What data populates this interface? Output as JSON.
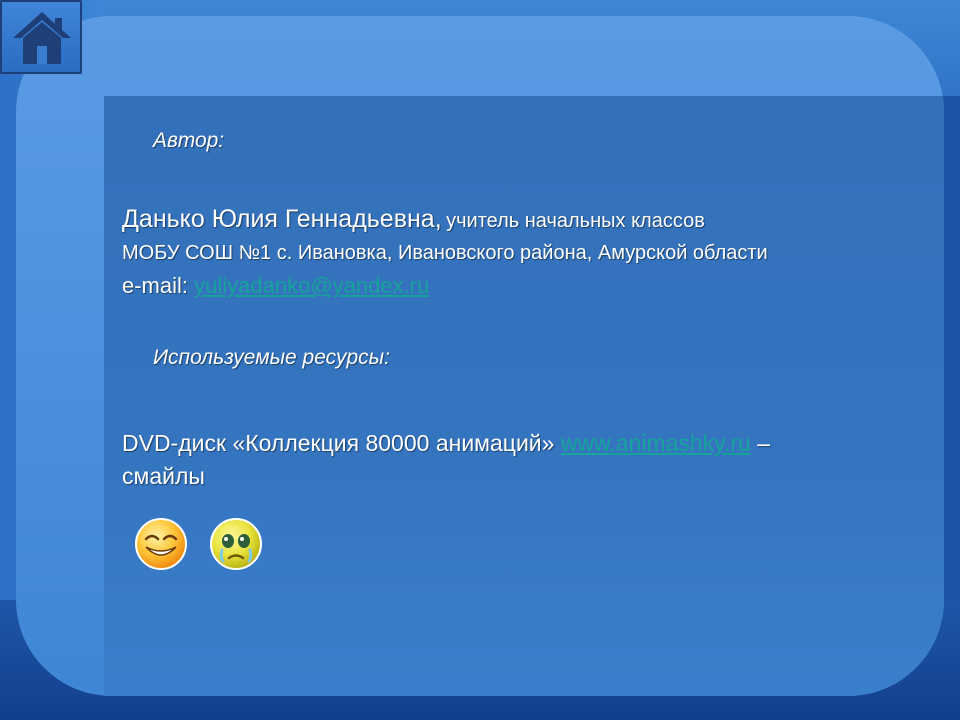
{
  "author": {
    "heading": "Автор:",
    "name": "Данько Юлия Геннадьевна,",
    "position": "учитель начальных классов",
    "school": "МОБУ СОШ №1 с. Ивановка, Ивановского района, Амурской области",
    "email_label": "e-mail:",
    "email": "yuliyadanko@yandex.ru"
  },
  "resources": {
    "heading": "Используемые ресурсы:",
    "text": "DVD-диск «Коллекция 80000 анимаций»",
    "link": "www.animashky.ru",
    "dash": "–",
    "suffix": "смайлы"
  },
  "icons": {
    "home": "home-icon",
    "smiley_happy": "happy-smiley-icon",
    "smiley_crying": "crying-smiley-icon"
  },
  "colors": {
    "background": "#1d54a8",
    "panel": "#4a8fdd",
    "content": "#3370ba",
    "link": "#16a39a",
    "text": "#ffffff"
  }
}
